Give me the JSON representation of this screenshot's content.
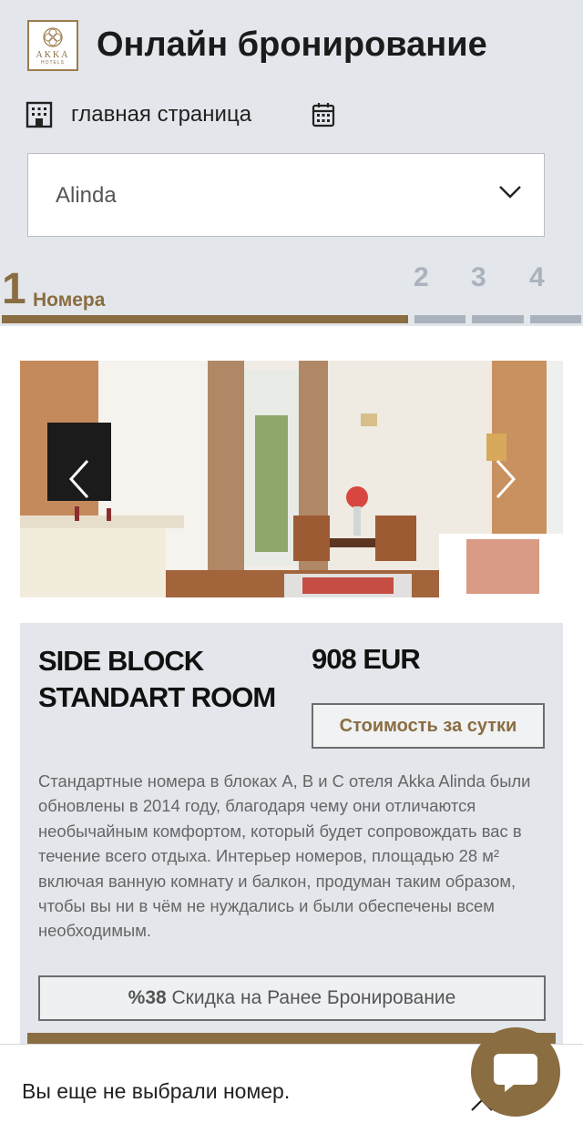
{
  "header": {
    "logo_brand": "AKKA",
    "logo_sub": "HOTELS",
    "title": "Онлайн бронирование",
    "home_icon": "hotel-building-icon",
    "home_label": "главная страница",
    "calendar_icon": "calendar-icon"
  },
  "hotel_select": {
    "value": "Alinda",
    "icon": "chevron-down-icon"
  },
  "steps": {
    "current_number": "1",
    "current_label": "Номера",
    "others": [
      "2",
      "3",
      "4"
    ],
    "active_color": "#8a6d41",
    "inactive_color": "#aab2bd"
  },
  "room": {
    "title": "SIDE BLOCK STANDART ROOM",
    "price": "908 EUR",
    "per_night_label": "Стоимость за сутки",
    "description": "Стандартные номера в блоках A, B и C отеля Akka Alinda были обновлены в 2014 году, благодаря чему они отличаются необычайным комфортом, который будет сопровождать вас в течение всего отдыха. Интерьер номеров, площадью 28 м² включая ванную комнату и балкон, продуман таким образом, чтобы вы ни в чём не нуждались и были обеспечены всем необходимым.",
    "discount_value": "%38",
    "discount_text": "Скидка на Ранее Бронирование",
    "prev_icon": "chevron-left-icon",
    "next_icon": "chevron-right-icon"
  },
  "footer": {
    "message": "Вы еще не выбрали номер.",
    "expand_icon": "chevron-up-icon",
    "chat_icon": "chat-bubble-icon"
  },
  "colors": {
    "accent": "#8a6d41",
    "background": "#e3e6ea"
  }
}
